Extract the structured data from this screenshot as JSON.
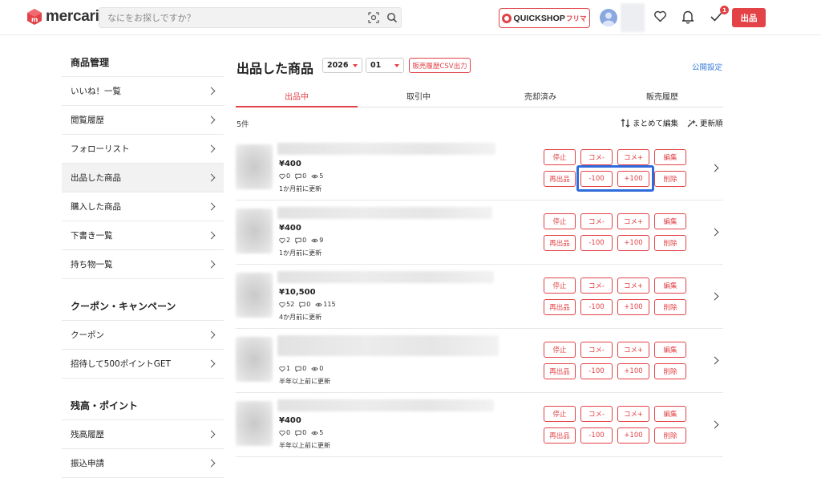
{
  "header": {
    "logo_text": "mercari",
    "search_placeholder": "なにをお探しですか？",
    "quickshop_label": "QUICKSHOP",
    "quickshop_sub": "フリマ",
    "todo_badge": "1",
    "sell_label": "出品",
    "colors": {
      "brand": "#e34247",
      "accent_blue": "#3b7ed8"
    }
  },
  "sidebar": {
    "sections": [
      {
        "heading": "商品管理",
        "items": [
          {
            "label": "いいね！一覧",
            "active": false
          },
          {
            "label": "閲覧履歴",
            "active": false
          },
          {
            "label": "フォローリスト",
            "active": false
          },
          {
            "label": "出品した商品",
            "active": true
          },
          {
            "label": "購入した商品",
            "active": false
          },
          {
            "label": "下書き一覧",
            "active": false
          },
          {
            "label": "持ち物一覧",
            "active": false
          }
        ]
      },
      {
        "heading": "クーポン・キャンペーン",
        "items": [
          {
            "label": "クーポン",
            "active": false
          },
          {
            "label": "招待して500ポイントGET",
            "active": false
          }
        ]
      },
      {
        "heading": "残高・ポイント",
        "items": [
          {
            "label": "残高履歴",
            "active": false
          },
          {
            "label": "振込申請",
            "active": false
          }
        ]
      }
    ]
  },
  "main": {
    "title": "出品した商品",
    "year": "2026",
    "month": "01",
    "csv_label": "販売履歴CSV出力",
    "public_settings": "公開設定",
    "tabs": [
      {
        "label": "出品中",
        "active": true
      },
      {
        "label": "取引中",
        "active": false
      },
      {
        "label": "売却済み",
        "active": false
      },
      {
        "label": "販売履歴",
        "active": false
      }
    ],
    "count": "5件",
    "bulk_edit": "まとめて編集",
    "sort_label": "更新順",
    "actions": {
      "stop": "停止",
      "comment_minus": "コメ-",
      "comment_plus": "コメ+",
      "edit": "編集",
      "relist": "再出品",
      "minus100": "-100",
      "plus100": "+100",
      "delete": "削除"
    },
    "items": [
      {
        "price": "¥400",
        "likes": "0",
        "comments": "0",
        "views": "5",
        "updated": "1か月前に更新"
      },
      {
        "price": "¥400",
        "likes": "2",
        "comments": "0",
        "views": "9",
        "updated": "1か月前に更新"
      },
      {
        "price": "¥10,500",
        "likes": "52",
        "comments": "0",
        "views": "115",
        "updated": "4か月前に更新"
      },
      {
        "price": "",
        "likes": "1",
        "comments": "0",
        "views": "0",
        "updated": "半年以上前に更新"
      },
      {
        "price": "¥400",
        "likes": "0",
        "comments": "0",
        "views": "5",
        "updated": "半年以上前に更新"
      }
    ]
  }
}
